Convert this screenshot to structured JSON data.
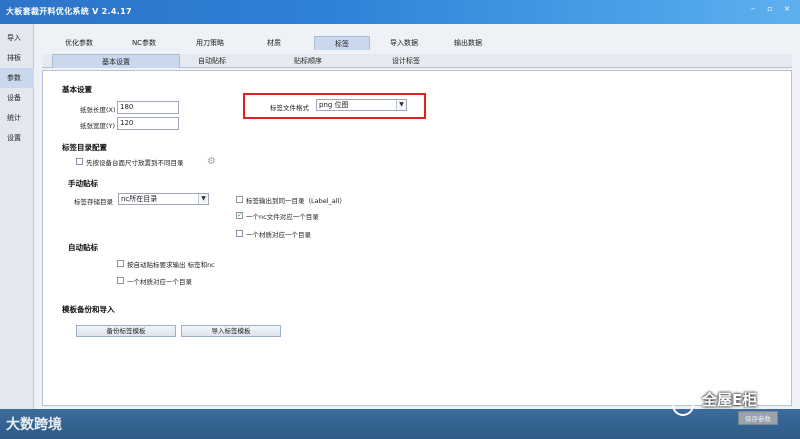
{
  "window": {
    "title": "大板套裁开料优化系统  V 2.4.17",
    "min_icon": "minimize-icon",
    "restore_icon": "restore-icon",
    "close_icon": "close-icon"
  },
  "leftnav": {
    "items": [
      {
        "label": "导入"
      },
      {
        "label": "排板"
      },
      {
        "label": "参数"
      },
      {
        "label": "设备"
      },
      {
        "label": "统计"
      },
      {
        "label": "设置"
      }
    ],
    "active_index": 2
  },
  "tabs": [
    {
      "label": "优化参数"
    },
    {
      "label": "NC参数"
    },
    {
      "label": "用刀策略"
    },
    {
      "label": "材质"
    },
    {
      "label": "标签"
    },
    {
      "label": "导入数据"
    },
    {
      "label": "输出数据"
    }
  ],
  "subtabs": [
    {
      "label": "基本设置"
    },
    {
      "label": "自动贴标"
    },
    {
      "label": "贴标顺序"
    },
    {
      "label": "设计标签"
    }
  ],
  "basic": {
    "section_title": "基本设置",
    "paper_length_label": "纸张长度(X)",
    "paper_length_value": "180",
    "paper_width_label": "纸张宽度(Y)",
    "paper_width_value": "120",
    "file_format_label": "标签文件格式",
    "file_format_value": "png 位图"
  },
  "dir_config": {
    "section_title": "标签目录配置",
    "by_device_size_label": "先按设备台面尺寸放置到不同目录"
  },
  "manual": {
    "section_title": "手动贴标",
    "storage_dir_label": "标签存储目录",
    "storage_dir_value": "nc所在目录",
    "same_dir_label": "标签输出到同一目录（Label_all）",
    "one_nc_label": "一个nc文件对应一个目录",
    "one_material_label": "一个材质对应一个目录"
  },
  "auto": {
    "section_title": "自动贴标",
    "auto_require_label": "按自动贴标要求输出 标签和nc",
    "one_material_label": "一个材质对应一个目录"
  },
  "template": {
    "section_title": "模板备份和导入",
    "backup_button": "备份标签模板",
    "import_button": "导入标签模板"
  },
  "footer": {
    "save_button": "保存参数",
    "watermark_left": "大数跨境",
    "watermark_right": "全屋E柜"
  },
  "colors": {
    "titlebar": "#2f80d8",
    "highlight": "#e0201e"
  }
}
